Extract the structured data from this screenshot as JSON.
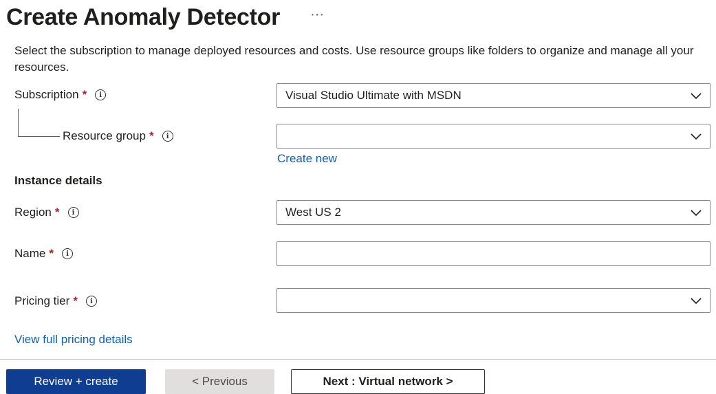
{
  "header": {
    "title": "Create Anomaly Detector",
    "more_label": "···"
  },
  "description": "Select the subscription to manage deployed resources and costs. Use resource groups like folders to organize and manage all your resources.",
  "fields": {
    "subscription": {
      "label": "Subscription",
      "required": "*",
      "info": "i",
      "value": "Visual Studio Ultimate with MSDN"
    },
    "resource_group": {
      "label": "Resource group",
      "required": "*",
      "info": "i",
      "value": ""
    },
    "region": {
      "label": "Region",
      "required": "*",
      "info": "i",
      "value": "West US 2"
    },
    "name": {
      "label": "Name",
      "required": "*",
      "info": "i",
      "value": ""
    },
    "pricing_tier": {
      "label": "Pricing tier",
      "required": "*",
      "info": "i",
      "value": ""
    }
  },
  "links": {
    "create_new": "Create new",
    "view_pricing": "View full pricing details"
  },
  "sections": {
    "instance_details": "Instance details"
  },
  "footer": {
    "review_create": "Review + create",
    "previous": "< Previous",
    "next": "Next : Virtual network >"
  },
  "colors": {
    "primary": "#0f3d91",
    "link": "#0f5fb3",
    "required": "#a4262c"
  },
  "icons": {
    "info": "info-icon",
    "dropdown": "chevron-down-icon",
    "more": "more-icon"
  }
}
